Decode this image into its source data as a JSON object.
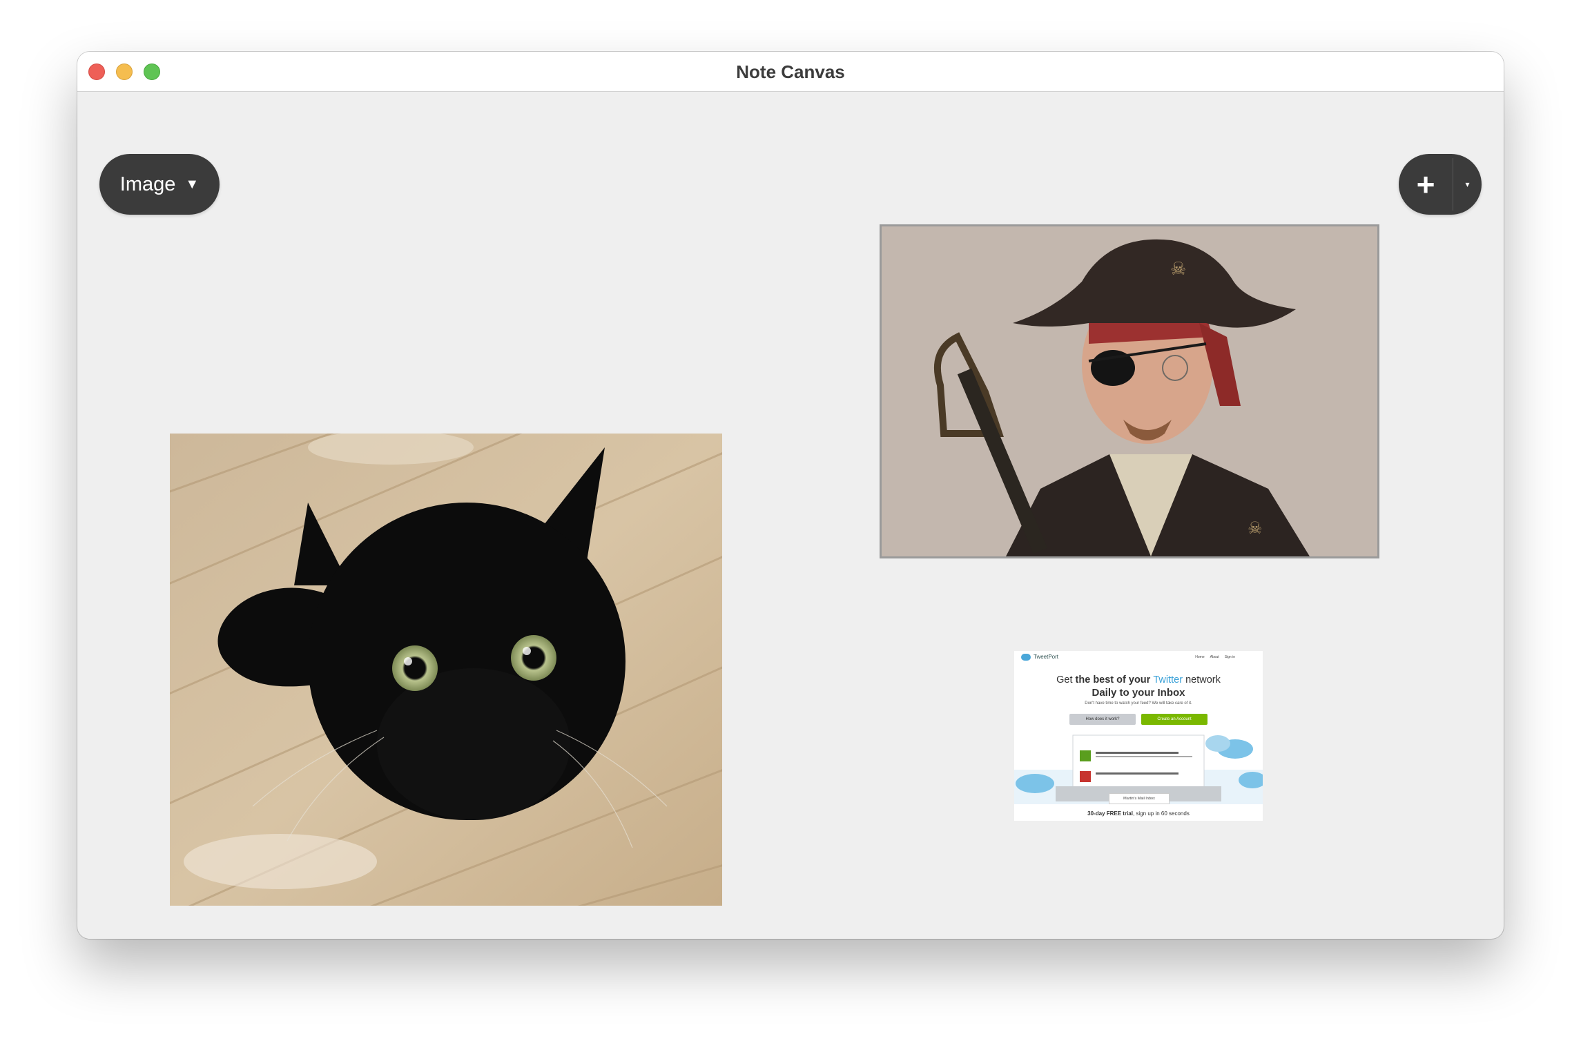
{
  "window": {
    "title": "Note Canvas"
  },
  "toolbar": {
    "type_dropdown": {
      "label": "Image",
      "arrow": "▼"
    },
    "add_button": {
      "label": "+",
      "more_arrow": "▾"
    }
  },
  "canvas": {
    "images": [
      {
        "subject": "black-cat-photo"
      },
      {
        "subject": "pirate-portrait-photo"
      },
      {
        "subject": "tweetport-website-screenshot",
        "logo": "TweetPort",
        "nav": [
          "Home",
          "About",
          "Sign in"
        ],
        "headline_prefix": "Get ",
        "headline_bold": "the best of your ",
        "headline_brand": "Twitter",
        "headline_suffix": " network",
        "headline_line2": "Daily to your Inbox",
        "subline": "Don't have time to watch your feed? We will take care of it.",
        "button_secondary": "How does it work?",
        "button_primary": "Create an Account",
        "inbox_label": "Martin's Mail Inbox",
        "footer_bold": "30-day FREE trial",
        "footer_rest": ", sign up in 60 seconds"
      }
    ]
  },
  "colors": {
    "canvas_bg": "#efefef",
    "pill_bg": "#3b3b3b",
    "twitter_blue": "#3aa1d8",
    "cta_green": "#7ab800"
  }
}
